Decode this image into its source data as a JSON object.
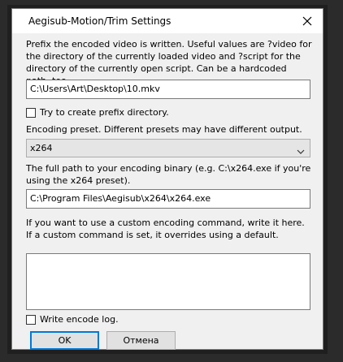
{
  "window": {
    "title": "Aegisub-Motion/Trim Settings",
    "close_icon": "close-icon"
  },
  "prefix": {
    "description": "Prefix the encoded video is written. Useful values are ?video for the directory of the currently loaded video and ?script for the directory of the currently open script. Can be a hardcoded path, too.",
    "value": "C:\\Users\\Art\\Desktop\\10.mkv",
    "create_dir_label": "Try to create prefix directory.",
    "create_dir_checked": false
  },
  "preset": {
    "description": "Encoding preset. Different presets may have different output.",
    "selected": "x264"
  },
  "binary": {
    "description": "The full path to your encoding binary (e.g. C:\\x264.exe if you're using the x264 preset).",
    "value": "C:\\Program Files\\Aegisub\\x264\\x264.exe"
  },
  "custom_command": {
    "description": "If you want to use a custom encoding command, write it here. If a custom command is set, it overrides using a default.",
    "value": ""
  },
  "log": {
    "label": "Write encode log.",
    "checked": false
  },
  "buttons": {
    "ok": "OK",
    "cancel": "Отмена"
  }
}
